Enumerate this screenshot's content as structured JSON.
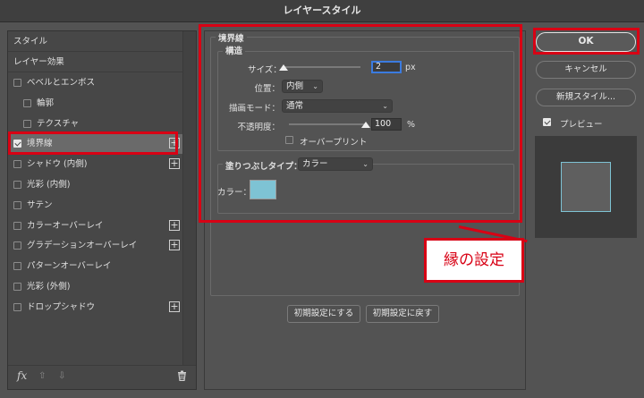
{
  "window": {
    "title": "レイヤースタイル"
  },
  "left_panel": {
    "header_items": [
      {
        "label": "スタイル"
      },
      {
        "label": "レイヤー効果"
      }
    ],
    "items": [
      {
        "label": "ベベルとエンボス",
        "checked": false,
        "indent": false,
        "plus": false
      },
      {
        "label": "輪郭",
        "checked": false,
        "indent": true,
        "plus": false
      },
      {
        "label": "テクスチャ",
        "checked": false,
        "indent": true,
        "plus": false
      },
      {
        "label": "境界線",
        "checked": true,
        "indent": false,
        "plus": true,
        "selected": true
      },
      {
        "label": "シャドウ (内側)",
        "checked": false,
        "indent": false,
        "plus": true
      },
      {
        "label": "光彩 (内側)",
        "checked": false,
        "indent": false,
        "plus": false
      },
      {
        "label": "サテン",
        "checked": false,
        "indent": false,
        "plus": false
      },
      {
        "label": "カラーオーバーレイ",
        "checked": false,
        "indent": false,
        "plus": true
      },
      {
        "label": "グラデーションオーバーレイ",
        "checked": false,
        "indent": false,
        "plus": true
      },
      {
        "label": "パターンオーバーレイ",
        "checked": false,
        "indent": false,
        "plus": false
      },
      {
        "label": "光彩 (外側)",
        "checked": false,
        "indent": false,
        "plus": false
      },
      {
        "label": "ドロップシャドウ",
        "checked": false,
        "indent": false,
        "plus": true
      }
    ],
    "footer": {
      "fx_label": "fx",
      "up_icon": "arrow-up-icon",
      "down_icon": "arrow-down-icon",
      "trash_icon": "trash-icon"
    }
  },
  "stroke": {
    "section_title": "境界線",
    "structure_title": "構造",
    "size_label": "サイズ：",
    "size_value": "2",
    "size_unit": "px",
    "size_slider_fraction": 0.0,
    "position_label": "位置：",
    "position_value": "内側",
    "blend_label": "描画モード：",
    "blend_value": "通常",
    "opacity_label": "不透明度：",
    "opacity_value": "100",
    "opacity_unit": "%",
    "opacity_slider_fraction": 1.0,
    "overprint_label": "オーバープリント",
    "overprint_checked": false,
    "fill_type_label": "塗りつぶしタイプ：",
    "fill_type_value": "カラー",
    "color_label": "カラー：",
    "color_value": "#7ec3d4"
  },
  "buttons": {
    "make_default": "初期設定にする",
    "reset_default": "初期設定に戻す",
    "ok": "OK",
    "cancel": "キャンセル",
    "new_style": "新規スタイル..."
  },
  "preview": {
    "label": "プレビュー",
    "checked": true
  },
  "annotation": {
    "callout_text": "縁の設定",
    "accent_color": "#d80014"
  }
}
